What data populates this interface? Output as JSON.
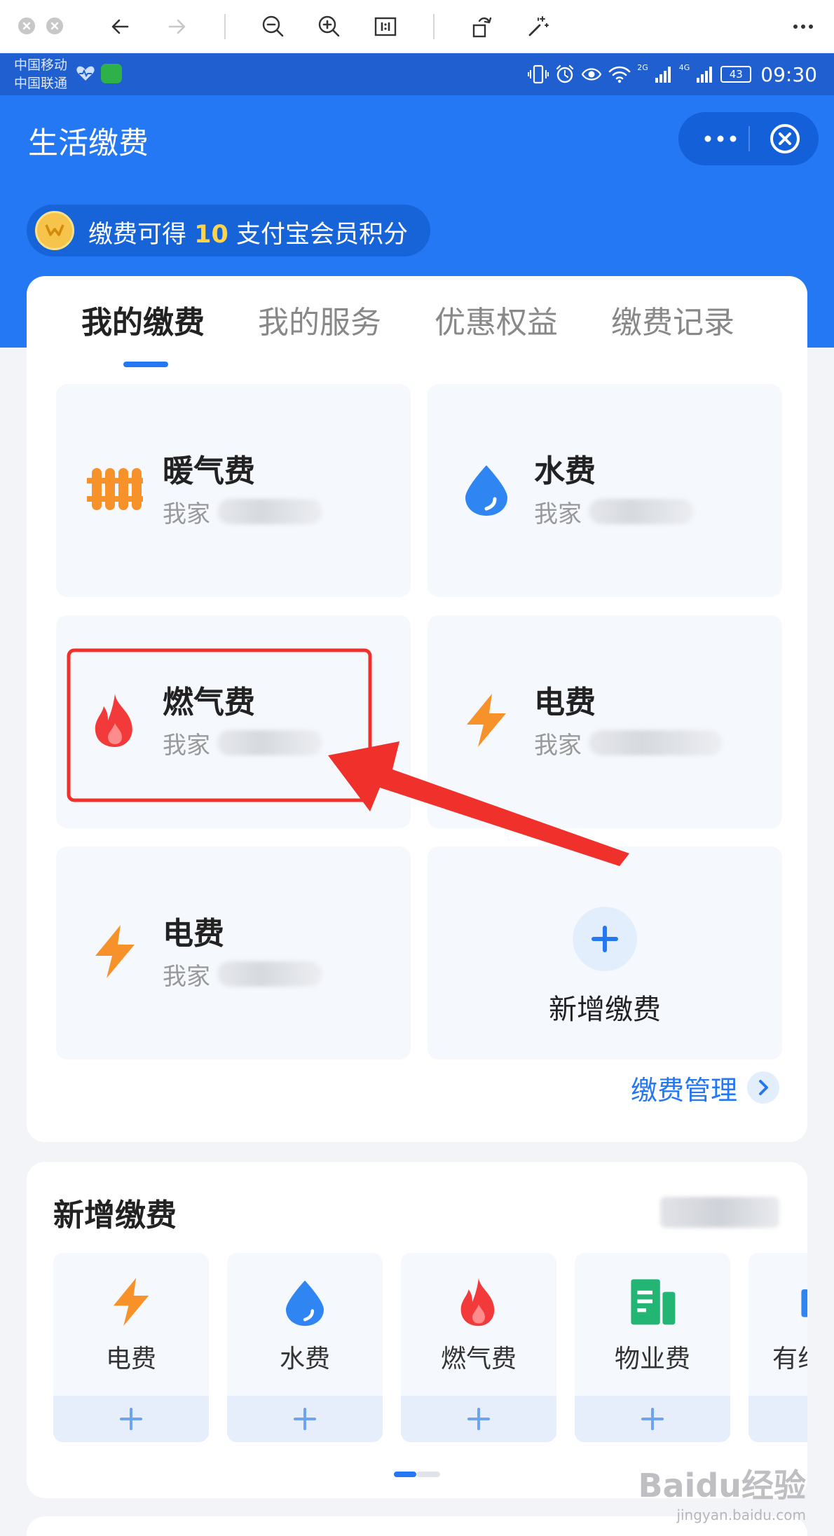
{
  "status_bar": {
    "carrier_1": "中国移动",
    "carrier_2": "中国联通",
    "battery": "43",
    "time": "09:30",
    "net_1": "2G",
    "net_2": "4G"
  },
  "header": {
    "title": "生活缴费",
    "promo_prefix": "缴费可得",
    "promo_points": "10",
    "promo_suffix": "支付宝会员积分"
  },
  "tabs": [
    {
      "label": "我的缴费",
      "active": true
    },
    {
      "label": "我的服务",
      "active": false
    },
    {
      "label": "优惠权益",
      "active": false
    },
    {
      "label": "缴费记录",
      "active": false
    }
  ],
  "my_payments": [
    {
      "name": "暖气费",
      "sub": "我家",
      "icon": "radiator-icon"
    },
    {
      "name": "水费",
      "sub": "我家",
      "icon": "water-drop-icon"
    },
    {
      "name": "燃气费",
      "sub": "我家",
      "icon": "gas-flame-icon"
    },
    {
      "name": "电费",
      "sub": "我家",
      "icon": "lightning-icon"
    },
    {
      "name": "电费",
      "sub": "我家",
      "icon": "lightning-icon"
    }
  ],
  "add_tile_label": "新增缴费",
  "manage_label": "缴费管理",
  "new_payment": {
    "title": "新增缴费",
    "items": [
      {
        "label": "电费",
        "icon": "lightning-icon"
      },
      {
        "label": "水费",
        "icon": "water-drop-icon"
      },
      {
        "label": "燃气费",
        "icon": "gas-flame-icon"
      },
      {
        "label": "物业费",
        "icon": "building-icon"
      },
      {
        "label": "有线",
        "icon": "tv-icon"
      }
    ]
  },
  "watermark": {
    "logo": "Baidu经验",
    "url": "jingyan.baidu.com"
  },
  "colors": {
    "brand_blue": "#2478f4",
    "annotation_red": "#f0302a",
    "heating_orange": "#f7922a",
    "gas_red": "#f23a3a",
    "property_green": "#22b573"
  }
}
